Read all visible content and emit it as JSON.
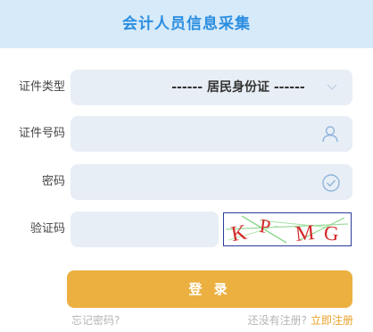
{
  "header": {
    "title": "会计人员信息采集"
  },
  "form": {
    "id_type_label": "证件类型",
    "id_type_value": "------ 居民身份证 ------",
    "id_number_label": "证件号码",
    "id_number_value": "",
    "password_label": "密码",
    "password_value": "",
    "captcha_label": "验证码",
    "captcha_value": "",
    "captcha_text": "KPMG"
  },
  "actions": {
    "login_label": "登 录",
    "forgot_label": "忘记密码?",
    "no_account_text": "还没有注册?",
    "register_label": "立即注册"
  },
  "colors": {
    "header_bg": "#d6eaf9",
    "accent_blue": "#2b8ee0",
    "button": "#ebb040",
    "link_orange": "#e8a22a"
  }
}
